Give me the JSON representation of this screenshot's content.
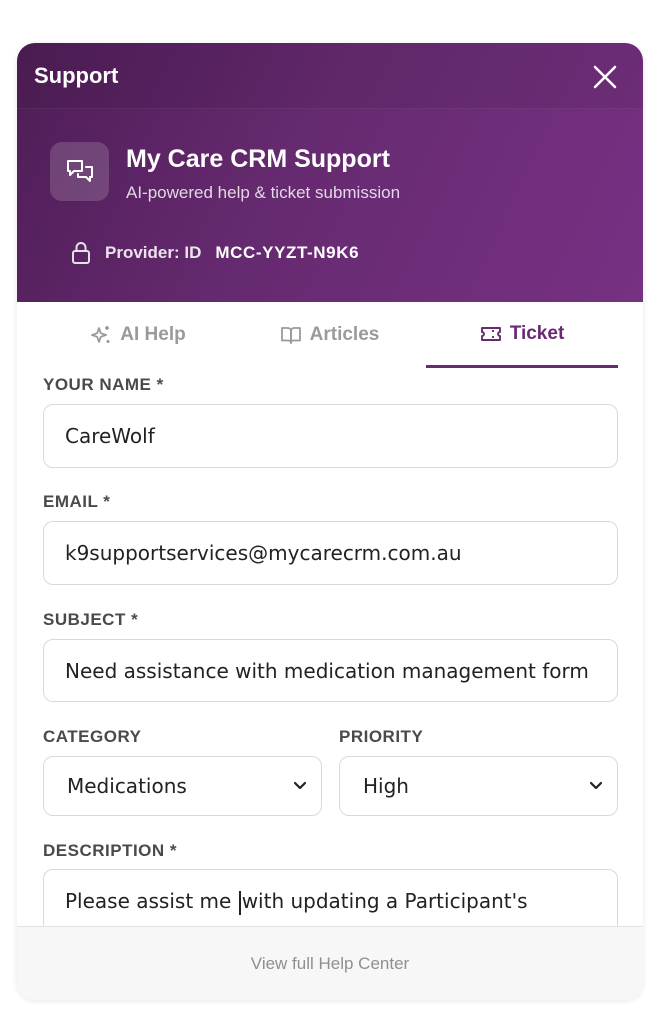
{
  "header": {
    "title": "Support",
    "brand_title": "My Care CRM Support",
    "brand_subtitle": "AI-powered help & ticket submission",
    "provider_label": "Provider: ID",
    "provider_id": "MCC-YYZT-N9K6"
  },
  "tabs": [
    {
      "label": "AI Help",
      "icon": "sparkles-icon",
      "active": false
    },
    {
      "label": "Articles",
      "icon": "book-icon",
      "active": false
    },
    {
      "label": "Ticket",
      "icon": "ticket-icon",
      "active": true
    }
  ],
  "form": {
    "name_label": "YOUR NAME *",
    "name_value": "CareWolf",
    "email_label": "EMAIL *",
    "email_value": "k9supportservices@mycarecrm.com.au",
    "subject_label": "SUBJECT *",
    "subject_value": "Need assistance with medication management form",
    "category_label": "CATEGORY",
    "category_value": "Medications",
    "priority_label": "PRIORITY",
    "priority_value": "High",
    "description_label": "DESCRIPTION *",
    "description_before_cursor": "Please assist me ",
    "description_after_cursor": "with updating a Participant's"
  },
  "footer": {
    "link_label": "View full Help Center"
  },
  "colors": {
    "accent": "#6a2a73",
    "header_gradient_start": "#4f1d57",
    "header_gradient_end": "#773183"
  }
}
